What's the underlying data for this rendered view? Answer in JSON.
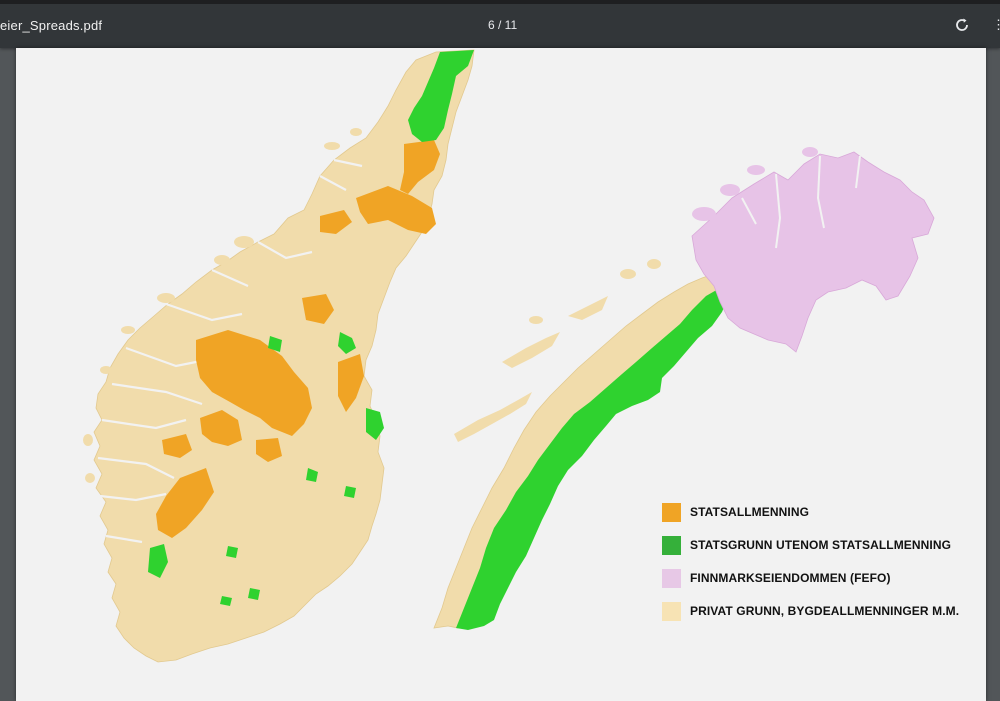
{
  "viewer": {
    "title": "eier_Spreads.pdf",
    "page_counter": "6 / 11",
    "more_glyph": "⋮"
  },
  "map": {
    "colors": {
      "statsallmenning": "#f0a425",
      "statsgrunn": "#2fd22f",
      "finnmark": "#e7c3e7",
      "privat": "#f1dcab",
      "background": "#f2f2f2"
    }
  },
  "legend": {
    "items": [
      {
        "label": "STATSALLMENNING",
        "color": "#f0a425"
      },
      {
        "label": "STATSGRUNN UTENOM STATSALLMENNING",
        "color": "#35b03a"
      },
      {
        "label": "FINNMARKSEIENDOMMEN (FEFO)",
        "color": "#e7c8e6"
      },
      {
        "label": "PRIVAT GRUNN, BYGDEALLMENNINGER M.M.",
        "color": "#f7e3b4"
      }
    ]
  }
}
